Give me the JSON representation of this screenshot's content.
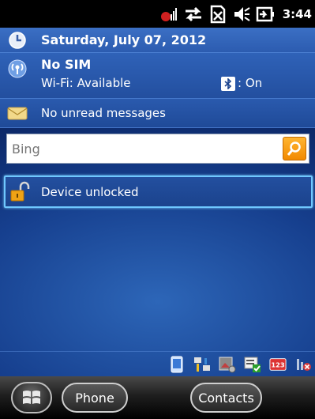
{
  "status_bar": {
    "time": "3:44",
    "icons": [
      "signal-icon",
      "sync-icon",
      "no-sim-icon",
      "speaker-icon",
      "battery-charging-icon"
    ]
  },
  "today": {
    "date": "Saturday, July 07, 2012",
    "sim_status": "No SIM",
    "wifi_status": "Wi-Fi: Available",
    "bluetooth_status": ": On",
    "messages": "No unread messages",
    "lock_status": "Device unlocked"
  },
  "search": {
    "placeholder": "Bing",
    "value": ""
  },
  "tray": {
    "icons": [
      "device-icon",
      "network-icon",
      "camera-settings-icon",
      "checkmark-card-icon",
      "input-123-icon",
      "disconnect-icon"
    ],
    "input_label": "123"
  },
  "softkeys": {
    "left": "Phone",
    "right": "Contacts"
  },
  "colors": {
    "accent_orange": "#f28a00",
    "selection_border": "#6fc8ff",
    "background_blue": "#163f8e"
  }
}
